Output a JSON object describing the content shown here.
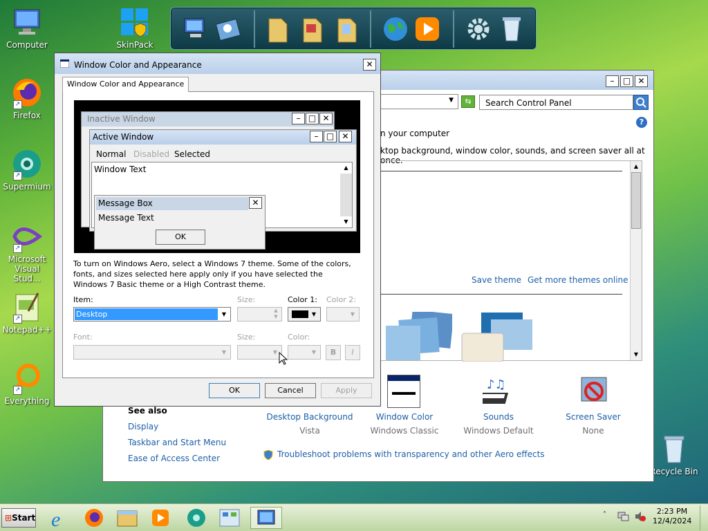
{
  "desktop": {
    "icons": [
      {
        "label": "Computer"
      },
      {
        "label": "SkinPack"
      },
      {
        "label": "Firefox"
      },
      {
        "label": "Supermium"
      },
      {
        "label": "Microsoft Visual Stud..."
      },
      {
        "label": "Notepad++"
      },
      {
        "label": "Everything"
      },
      {
        "label": "Recycle Bin"
      }
    ]
  },
  "control_panel": {
    "search_placeholder": "Search Control Panel",
    "heading_partial": "n your computer",
    "desc_partial": "ktop background, window color, sounds, and screen saver all at once.",
    "save_theme": "Save theme",
    "get_more_themes": "Get more themes online",
    "see_also": "See also",
    "see_also_links": [
      "Display",
      "Taskbar and Start Menu",
      "Ease of Access Center"
    ],
    "items": [
      {
        "label": "Desktop Background",
        "value": "Vista"
      },
      {
        "label": "Window Color",
        "value": "Windows Classic"
      },
      {
        "label": "Sounds",
        "value": "Windows Default"
      },
      {
        "label": "Screen Saver",
        "value": "None"
      }
    ],
    "troubleshoot": "Troubleshoot problems with transparency and other Aero effects"
  },
  "dialog": {
    "title": "Window Color and Appearance",
    "tab": "Window Color and Appearance",
    "preview": {
      "inactive_title": "Inactive Window",
      "active_title": "Active Window",
      "menu": [
        "Normal",
        "Disabled",
        "Selected"
      ],
      "window_text": "Window Text",
      "msgbox_title": "Message Box",
      "msgbox_text": "Message Text",
      "msgbox_ok": "OK"
    },
    "info": "To turn on Windows Aero, select a Windows 7 theme.  Some of the colors, fonts, and sizes selected here apply only if you have selected the Windows 7 Basic theme or a High Contrast theme.",
    "item_label": "Item:",
    "item_value": "Desktop",
    "size_label": "Size:",
    "color1_label": "Color 1:",
    "color2_label": "Color 2:",
    "font_label": "Font:",
    "size2_label": "Size:",
    "color_label": "Color:",
    "bold": "B",
    "italic": "I",
    "ok": "OK",
    "cancel": "Cancel",
    "apply": "Apply"
  },
  "taskbar": {
    "start": "Start",
    "time": "2:23 PM",
    "date": "12/4/2024"
  },
  "colors": {
    "selected": "#3399ff",
    "link": "#1d5fa8"
  }
}
